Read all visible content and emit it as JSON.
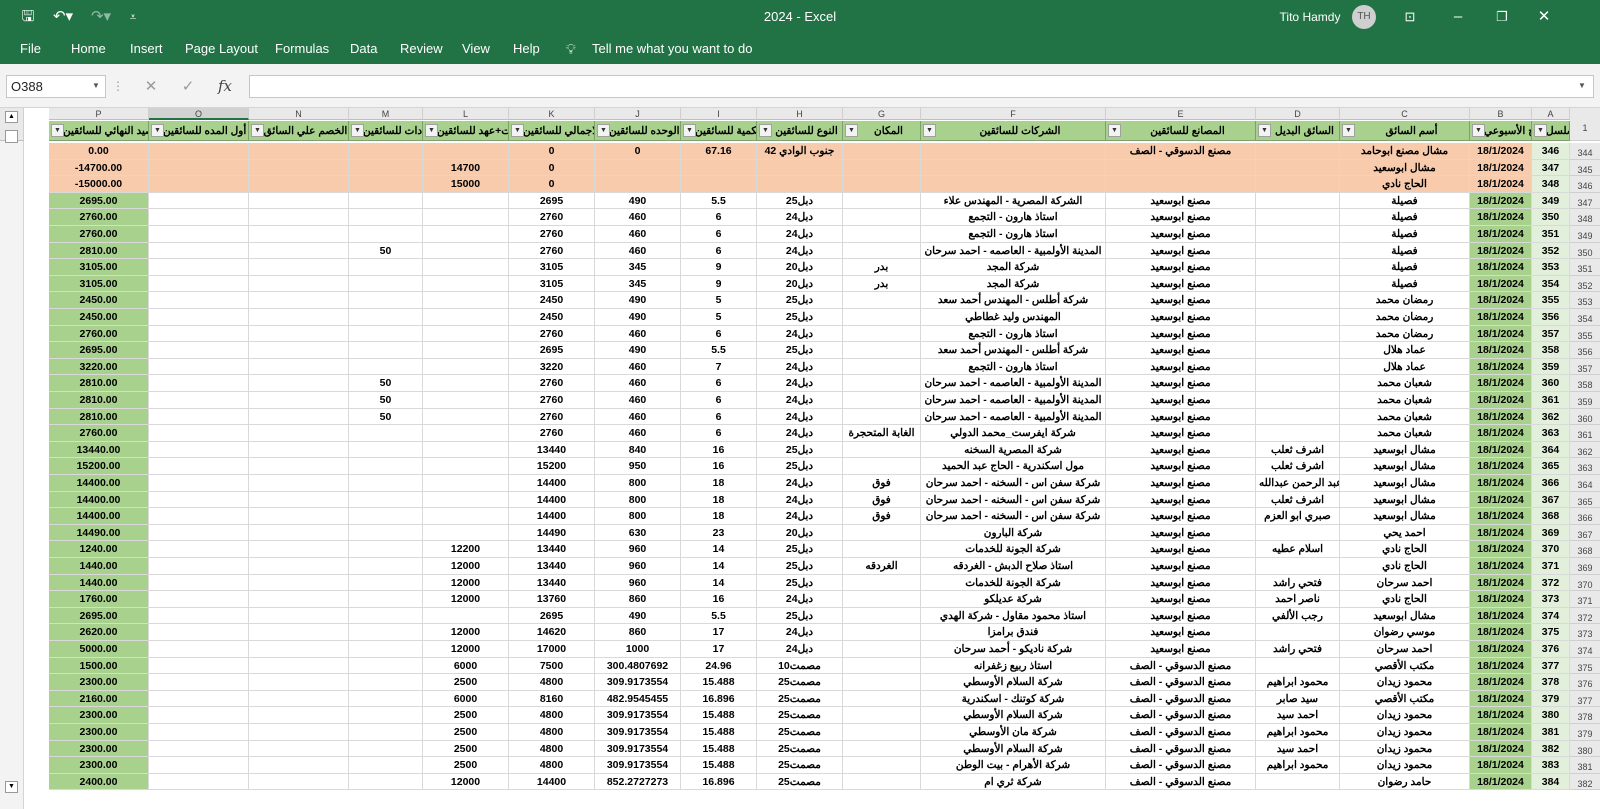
{
  "titlebar": {
    "doc_title": "2024  -  Excel",
    "user": "Tito Hamdy",
    "avatar_initials": "TH"
  },
  "menu": [
    "File",
    "Home",
    "Insert",
    "Page Layout",
    "Formulas",
    "Data",
    "Review",
    "View",
    "Help"
  ],
  "tellme": "Tell me what you want to do",
  "formula": {
    "name_box": "O388",
    "fx": "fx",
    "value": ""
  },
  "columns": [
    {
      "letter": "A",
      "header": "التسلسل"
    },
    {
      "letter": "B",
      "header": "التاريخ الأسبوعي"
    },
    {
      "letter": "C",
      "header": "أسم السائق"
    },
    {
      "letter": "D",
      "header": "السائق البديل"
    },
    {
      "letter": "E",
      "header": "المصانع للسائقين"
    },
    {
      "letter": "F",
      "header": "الشركات للسائقين"
    },
    {
      "letter": "G",
      "header": "المكان"
    },
    {
      "letter": "H",
      "header": "النوع للسائقين"
    },
    {
      "letter": "I",
      "header": "الكمية للسائقين"
    },
    {
      "letter": "J",
      "header": "سعر الوحده للسائقين"
    },
    {
      "letter": "K",
      "header": "الاجمالي للسائقين"
    },
    {
      "letter": "L",
      "header": "مدفوعات+عهد للسائقين"
    },
    {
      "letter": "M",
      "header": "زيادات للسائقين"
    },
    {
      "letter": "N",
      "header": "الخصم علي السائق"
    },
    {
      "letter": "O",
      "header": "رصيد أول المده للسائقين"
    },
    {
      "letter": "P",
      "header": "الرصيد النهائي للسائقين"
    }
  ],
  "rows": [
    {
      "n": "344",
      "cells": [
        "346",
        "18/1/2024",
        "مشال مصنع ابوحامد",
        "",
        "مصنع الدسوقي - الصف",
        "",
        "",
        "جنوب الوادي 42",
        "67.16",
        "0",
        "0",
        "",
        "",
        "",
        "",
        "0.00"
      ]
    },
    {
      "n": "345",
      "cells": [
        "347",
        "18/1/2024",
        "مشال ابوسعيد",
        "",
        "",
        "",
        "",
        "",
        "",
        "",
        "0",
        "14700",
        "",
        "",
        "",
        "-14700.00"
      ]
    },
    {
      "n": "346",
      "cells": [
        "348",
        "18/1/2024",
        "الحاج نادي",
        "",
        "",
        "",
        "",
        "",
        "",
        "",
        "0",
        "15000",
        "",
        "",
        "",
        "-15000.00"
      ]
    },
    {
      "n": "347",
      "cells": [
        "349",
        "18/1/2024",
        "فصيلة",
        "",
        "مصنع ابوسعيد",
        "الشركة المصرية - المهندس علاء",
        "",
        "دبل25",
        "5.5",
        "490",
        "2695",
        "",
        "",
        "",
        "",
        "2695.00"
      ]
    },
    {
      "n": "348",
      "cells": [
        "350",
        "18/1/2024",
        "فصيلة",
        "",
        "مصنع ابوسعيد",
        "استاذ هارون - التجمع",
        "",
        "دبل24",
        "6",
        "460",
        "2760",
        "",
        "",
        "",
        "",
        "2760.00"
      ]
    },
    {
      "n": "349",
      "cells": [
        "351",
        "18/1/2024",
        "فصيلة",
        "",
        "مصنع ابوسعيد",
        "استاذ هارون - التجمع",
        "",
        "دبل24",
        "6",
        "460",
        "2760",
        "",
        "",
        "",
        "",
        "2760.00"
      ]
    },
    {
      "n": "350",
      "cells": [
        "352",
        "18/1/2024",
        "فصيلة",
        "",
        "مصنع ابوسعيد",
        "المدينة الأولمبية - العاصمه - احمد سرحان",
        "",
        "دبل24",
        "6",
        "460",
        "2760",
        "",
        "50",
        "",
        "",
        "2810.00"
      ]
    },
    {
      "n": "351",
      "cells": [
        "353",
        "18/1/2024",
        "فصيلة",
        "",
        "مصنع ابوسعيد",
        "شركة المجد",
        "بدر",
        "دبل20",
        "9",
        "345",
        "3105",
        "",
        "",
        "",
        "",
        "3105.00"
      ]
    },
    {
      "n": "352",
      "cells": [
        "354",
        "18/1/2024",
        "فصيلة",
        "",
        "مصنع ابوسعيد",
        "شركة المجد",
        "بدر",
        "دبل20",
        "9",
        "345",
        "3105",
        "",
        "",
        "",
        "",
        "3105.00"
      ]
    },
    {
      "n": "353",
      "cells": [
        "355",
        "18/1/2024",
        "رمضان محمد",
        "",
        "مصنع ابوسعيد",
        "شركة أطلس - المهندس أحمد سعد",
        "",
        "دبل25",
        "5",
        "490",
        "2450",
        "",
        "",
        "",
        "",
        "2450.00"
      ]
    },
    {
      "n": "354",
      "cells": [
        "356",
        "18/1/2024",
        "رمضان محمد",
        "",
        "مصنع ابوسعيد",
        "المهندس وليد غطاطي",
        "",
        "دبل25",
        "5",
        "490",
        "2450",
        "",
        "",
        "",
        "",
        "2450.00"
      ]
    },
    {
      "n": "355",
      "cells": [
        "357",
        "18/1/2024",
        "رمضان محمد",
        "",
        "مصنع ابوسعيد",
        "استاذ هارون - التجمع",
        "",
        "دبل24",
        "6",
        "460",
        "2760",
        "",
        "",
        "",
        "",
        "2760.00"
      ]
    },
    {
      "n": "356",
      "cells": [
        "358",
        "18/1/2024",
        "عماد هلال",
        "",
        "مصنع ابوسعيد",
        "شركة أطلس - المهندس أحمد سعد",
        "",
        "دبل25",
        "5.5",
        "490",
        "2695",
        "",
        "",
        "",
        "",
        "2695.00"
      ]
    },
    {
      "n": "357",
      "cells": [
        "359",
        "18/1/2024",
        "عماد هلال",
        "",
        "مصنع ابوسعيد",
        "استاذ هارون - التجمع",
        "",
        "دبل24",
        "7",
        "460",
        "3220",
        "",
        "",
        "",
        "",
        "3220.00"
      ]
    },
    {
      "n": "358",
      "cells": [
        "360",
        "18/1/2024",
        "شعبان محمد",
        "",
        "مصنع ابوسعيد",
        "المدينة الأولمبية - العاصمه - احمد سرحان",
        "",
        "دبل24",
        "6",
        "460",
        "2760",
        "",
        "50",
        "",
        "",
        "2810.00"
      ]
    },
    {
      "n": "359",
      "cells": [
        "361",
        "18/1/2024",
        "شعبان محمد",
        "",
        "مصنع ابوسعيد",
        "المدينة الأولمبية - العاصمه - احمد سرحان",
        "",
        "دبل24",
        "6",
        "460",
        "2760",
        "",
        "50",
        "",
        "",
        "2810.00"
      ]
    },
    {
      "n": "360",
      "cells": [
        "362",
        "18/1/2024",
        "شعبان محمد",
        "",
        "مصنع ابوسعيد",
        "المدينة الأولمبية - العاصمه - احمد سرحان",
        "",
        "دبل24",
        "6",
        "460",
        "2760",
        "",
        "50",
        "",
        "",
        "2810.00"
      ]
    },
    {
      "n": "361",
      "cells": [
        "363",
        "18/1/2024",
        "شعبان محمد",
        "",
        "مصنع ابوسعيد",
        "شركة ايفرست_محمد الدولي",
        "الغابة المتحجرة",
        "دبل24",
        "6",
        "460",
        "2760",
        "",
        "",
        "",
        "",
        "2760.00"
      ]
    },
    {
      "n": "362",
      "cells": [
        "364",
        "18/1/2024",
        "مشال ابوسعيد",
        "اشرف ثعلب",
        "مصنع ابوسعيد",
        "شركة المصرية السخنه",
        "",
        "دبل25",
        "16",
        "840",
        "13440",
        "",
        "",
        "",
        "",
        "13440.00"
      ]
    },
    {
      "n": "363",
      "cells": [
        "365",
        "18/1/2024",
        "مشال ابوسعيد",
        "اشرف ثعلب",
        "مصنع ابوسعيد",
        "مول اسكندرية - الحاج عبد الحميد",
        "",
        "دبل25",
        "16",
        "950",
        "15200",
        "",
        "",
        "",
        "",
        "15200.00"
      ]
    },
    {
      "n": "364",
      "cells": [
        "366",
        "18/1/2024",
        "مشال ابوسعيد",
        "عبد الرحمن عبدالله",
        "مصنع ابوسعيد",
        "شركة سفن اس - السخنه - احمد سرحان",
        "فوق",
        "دبل24",
        "18",
        "800",
        "14400",
        "",
        "",
        "",
        "",
        "14400.00"
      ]
    },
    {
      "n": "365",
      "cells": [
        "367",
        "18/1/2024",
        "مشال ابوسعيد",
        "اشرف ثعلب",
        "مصنع ابوسعيد",
        "شركة سفن اس - السخنه - احمد سرحان",
        "فوق",
        "دبل24",
        "18",
        "800",
        "14400",
        "",
        "",
        "",
        "",
        "14400.00"
      ]
    },
    {
      "n": "366",
      "cells": [
        "368",
        "18/1/2024",
        "مشال ابوسعيد",
        "صبري ابو العزم",
        "مصنع ابوسعيد",
        "شركة سفن اس - السخنه - احمد سرحان",
        "فوق",
        "دبل24",
        "18",
        "800",
        "14400",
        "",
        "",
        "",
        "",
        "14400.00"
      ]
    },
    {
      "n": "367",
      "cells": [
        "369",
        "18/1/2024",
        "احمد يحي",
        "",
        "مصنع ابوسعيد",
        "شركة البارون",
        "",
        "دبل20",
        "23",
        "630",
        "14490",
        "",
        "",
        "",
        "",
        "14490.00"
      ]
    },
    {
      "n": "368",
      "cells": [
        "370",
        "18/1/2024",
        "الحاج نادي",
        "اسلام عطيه",
        "مصنع ابوسعيد",
        "شركة الجونة للخدمات",
        "",
        "دبل25",
        "14",
        "960",
        "13440",
        "12200",
        "",
        "",
        "",
        "1240.00"
      ]
    },
    {
      "n": "369",
      "cells": [
        "371",
        "18/1/2024",
        "الحاج نادي",
        "",
        "مصنع ابوسعيد",
        "استاذ صلاح الدبش - الغردقه",
        "الغردقه",
        "دبل25",
        "14",
        "960",
        "13440",
        "12000",
        "",
        "",
        "",
        "1440.00"
      ]
    },
    {
      "n": "370",
      "cells": [
        "372",
        "18/1/2024",
        "احمد سرحان",
        "فتحي راشد",
        "مصنع ابوسعيد",
        "شركة الجونة للخدمات",
        "",
        "دبل25",
        "14",
        "960",
        "13440",
        "12000",
        "",
        "",
        "",
        "1440.00"
      ]
    },
    {
      "n": "371",
      "cells": [
        "373",
        "18/1/2024",
        "الحاج نادي",
        "ناصر احمد",
        "مصنع ابوسعيد",
        "شركة عديلكو",
        "",
        "دبل24",
        "16",
        "860",
        "13760",
        "12000",
        "",
        "",
        "",
        "1760.00"
      ]
    },
    {
      "n": "372",
      "cells": [
        "374",
        "18/1/2024",
        "مشال ابوسعيد",
        "رجب الألفي",
        "مصنع ابوسعيد",
        "استاذ محمود مقاول - شركة الهدي",
        "",
        "دبل25",
        "5.5",
        "490",
        "2695",
        "",
        "",
        "",
        "",
        "2695.00"
      ]
    },
    {
      "n": "373",
      "cells": [
        "375",
        "18/1/2024",
        "موسي رضوان",
        "",
        "مصنع ابوسعيد",
        "فندق برامزا",
        "",
        "دبل24",
        "17",
        "860",
        "14620",
        "12000",
        "",
        "",
        "",
        "2620.00"
      ]
    },
    {
      "n": "374",
      "cells": [
        "376",
        "18/1/2024",
        "احمد سرحان",
        "فتحي راشد",
        "مصنع ابوسعيد",
        "شركة ناديكو - أحمد سرحان",
        "",
        "دبل24",
        "17",
        "1000",
        "17000",
        "12000",
        "",
        "",
        "",
        "5000.00"
      ]
    },
    {
      "n": "375",
      "cells": [
        "377",
        "18/1/2024",
        "مكتب الأقصي",
        "",
        "مصنع الدسوقي - الصف",
        "استاذ ربيع زغفرانه",
        "",
        "مصمت10",
        "24.96",
        "300.4807692",
        "7500",
        "6000",
        "",
        "",
        "",
        "1500.00"
      ]
    },
    {
      "n": "376",
      "cells": [
        "378",
        "18/1/2024",
        "محمود زيدان",
        "محمود ابراهيم",
        "مصنع الدسوقي - الصف",
        "شركة السلام الأوسطي",
        "",
        "مصمت25",
        "15.488",
        "309.9173554",
        "4800",
        "2500",
        "",
        "",
        "",
        "2300.00"
      ]
    },
    {
      "n": "377",
      "cells": [
        "379",
        "18/1/2024",
        "مكتب الأقصي",
        "سيد صابر",
        "مصنع الدسوقي - الصف",
        "شركة كوتنك - اسكندرية",
        "",
        "مصمت25",
        "16.896",
        "482.9545455",
        "8160",
        "6000",
        "",
        "",
        "",
        "2160.00"
      ]
    },
    {
      "n": "378",
      "cells": [
        "380",
        "18/1/2024",
        "محمود زيدان",
        "احمد سيد",
        "مصنع الدسوقي - الصف",
        "شركة السلام الأوسطي",
        "",
        "مصمت25",
        "15.488",
        "309.9173554",
        "4800",
        "2500",
        "",
        "",
        "",
        "2300.00"
      ]
    },
    {
      "n": "379",
      "cells": [
        "381",
        "18/1/2024",
        "محمود زيدان",
        "محمود ابراهيم",
        "مصنع الدسوقي - الصف",
        "شركة مان الأوسطي",
        "",
        "مصمت25",
        "15.488",
        "309.9173554",
        "4800",
        "2500",
        "",
        "",
        "",
        "2300.00"
      ]
    },
    {
      "n": "380",
      "cells": [
        "382",
        "18/1/2024",
        "محمود زيدان",
        "احمد سيد",
        "مصنع الدسوقي - الصف",
        "شركة السلام الأوسطي",
        "",
        "مصمت25",
        "15.488",
        "309.9173554",
        "4800",
        "2500",
        "",
        "",
        "",
        "2300.00"
      ]
    },
    {
      "n": "381",
      "cells": [
        "383",
        "18/1/2024",
        "محمود زيدان",
        "محمود ابراهيم",
        "مصنع الدسوقي - الصف",
        "شركة الأهرام - بيت الوطن",
        "",
        "مصمت25",
        "15.488",
        "309.9173554",
        "4800",
        "2500",
        "",
        "",
        "",
        "2300.00"
      ]
    },
    {
      "n": "382",
      "cells": [
        "384",
        "18/1/2024",
        "حامد رضوان",
        "",
        "مصنع الدسوقي - الصف",
        "شركة ثري ام",
        "",
        "مصمت25",
        "16.896",
        "852.2727273",
        "14400",
        "12000",
        "",
        "",
        "",
        "2400.00"
      ]
    }
  ],
  "colors": {
    "brand": "#217346",
    "header_green": "#a9d18e",
    "highlight_orange": "#f8cbad",
    "date_green": "#a9d18e",
    "final_green": "#a9d18e"
  }
}
